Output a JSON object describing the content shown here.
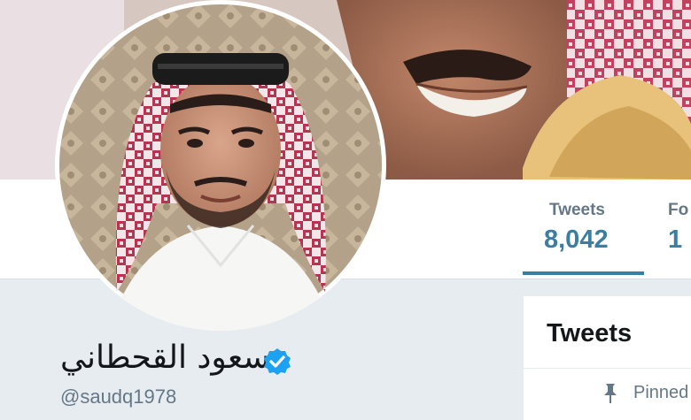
{
  "profile": {
    "display_name": "سعود القحطاني",
    "handle": "@saudq1978",
    "verified_icon": "verified-badge-icon"
  },
  "nav": {
    "tweets_label": "Tweets",
    "tweets_count": "8,042",
    "following_label": "Fo",
    "following_count": "1"
  },
  "timeline": {
    "title": "Tweets",
    "pinned_label": "Pinned",
    "pin_icon": "pin-icon"
  },
  "colors": {
    "accent": "#3b7ea1",
    "verified": "#1da1f2",
    "secondary_text": "#657786",
    "page_bg": "#e6ecf0"
  }
}
